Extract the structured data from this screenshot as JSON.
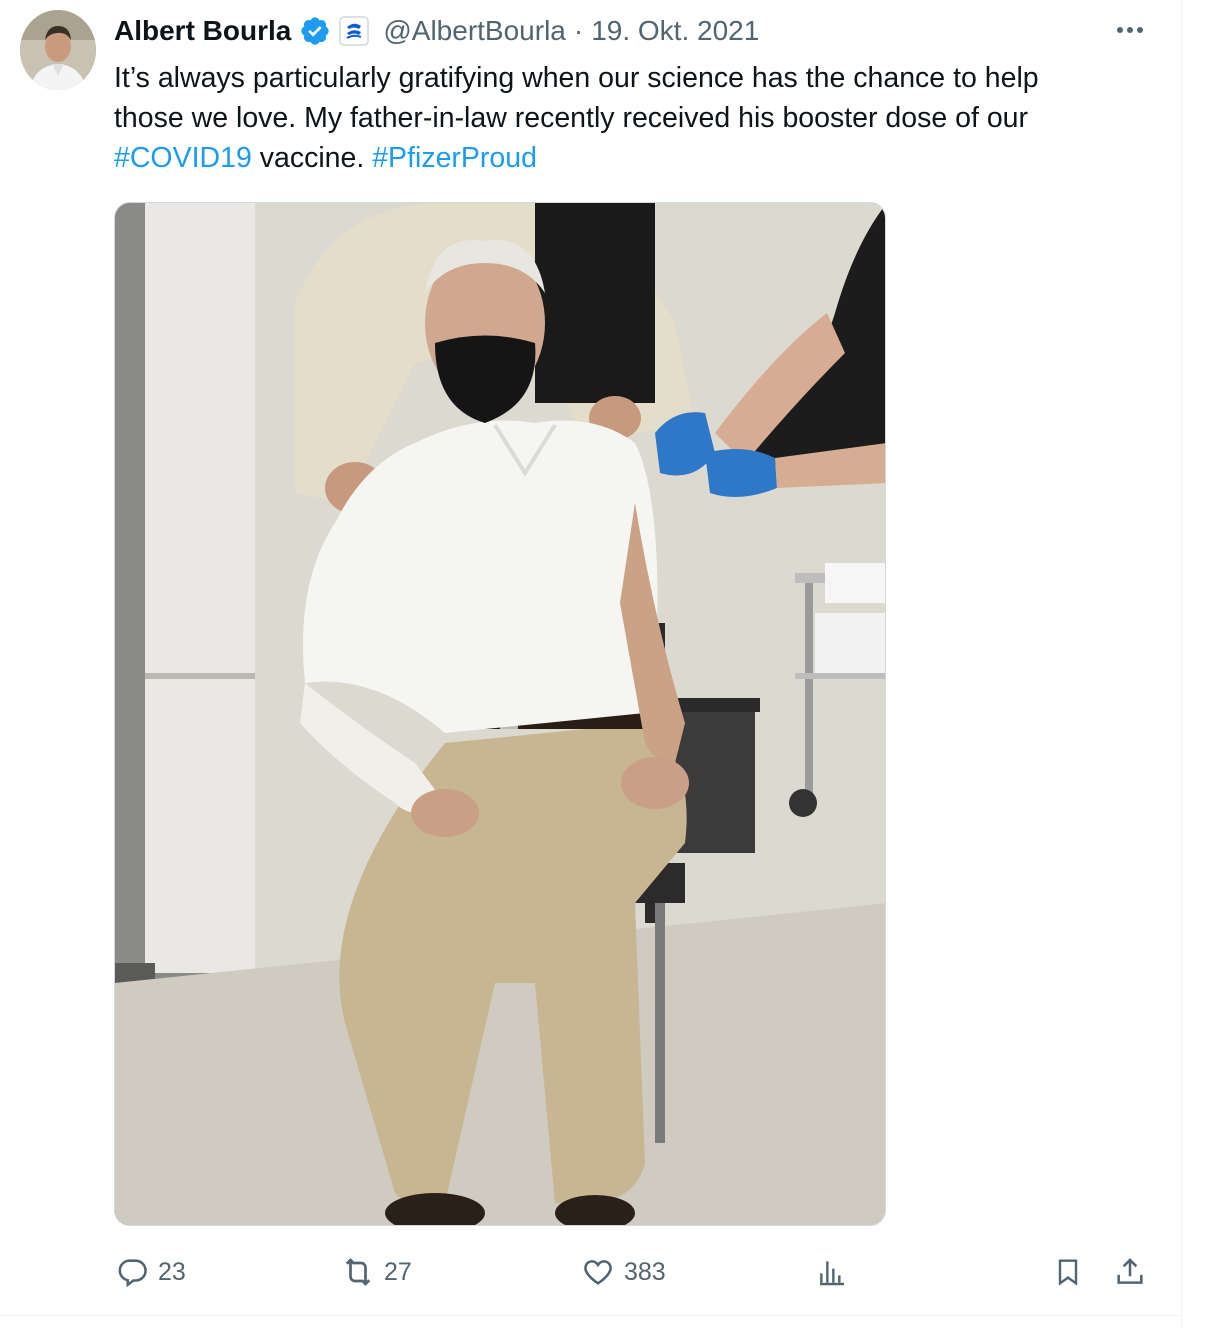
{
  "tweet": {
    "author": {
      "display_name": "Albert Bourla",
      "handle": "@AlbertBourla",
      "verified_icon": "verified-badge-icon",
      "affiliation_icon": "pfizer-affiliation-icon"
    },
    "separator": "·",
    "date": "19. Okt. 2021",
    "text_lines": [
      "It’s always particularly gratifying when our science has the chance to help",
      "those we love. My father-in-law recently received his booster dose of our"
    ],
    "hashtag_1": "#COVID19",
    "text_middle": " vaccine. ",
    "hashtag_2": "#PfizerProud",
    "media_description_icon": "photo",
    "actions": {
      "replies": "23",
      "reposts": "27",
      "likes": "383"
    }
  },
  "colors": {
    "accent": "#1d9bf0",
    "secondary_text": "#536471",
    "primary_text": "#0f1419",
    "border": "#eff3f4"
  }
}
